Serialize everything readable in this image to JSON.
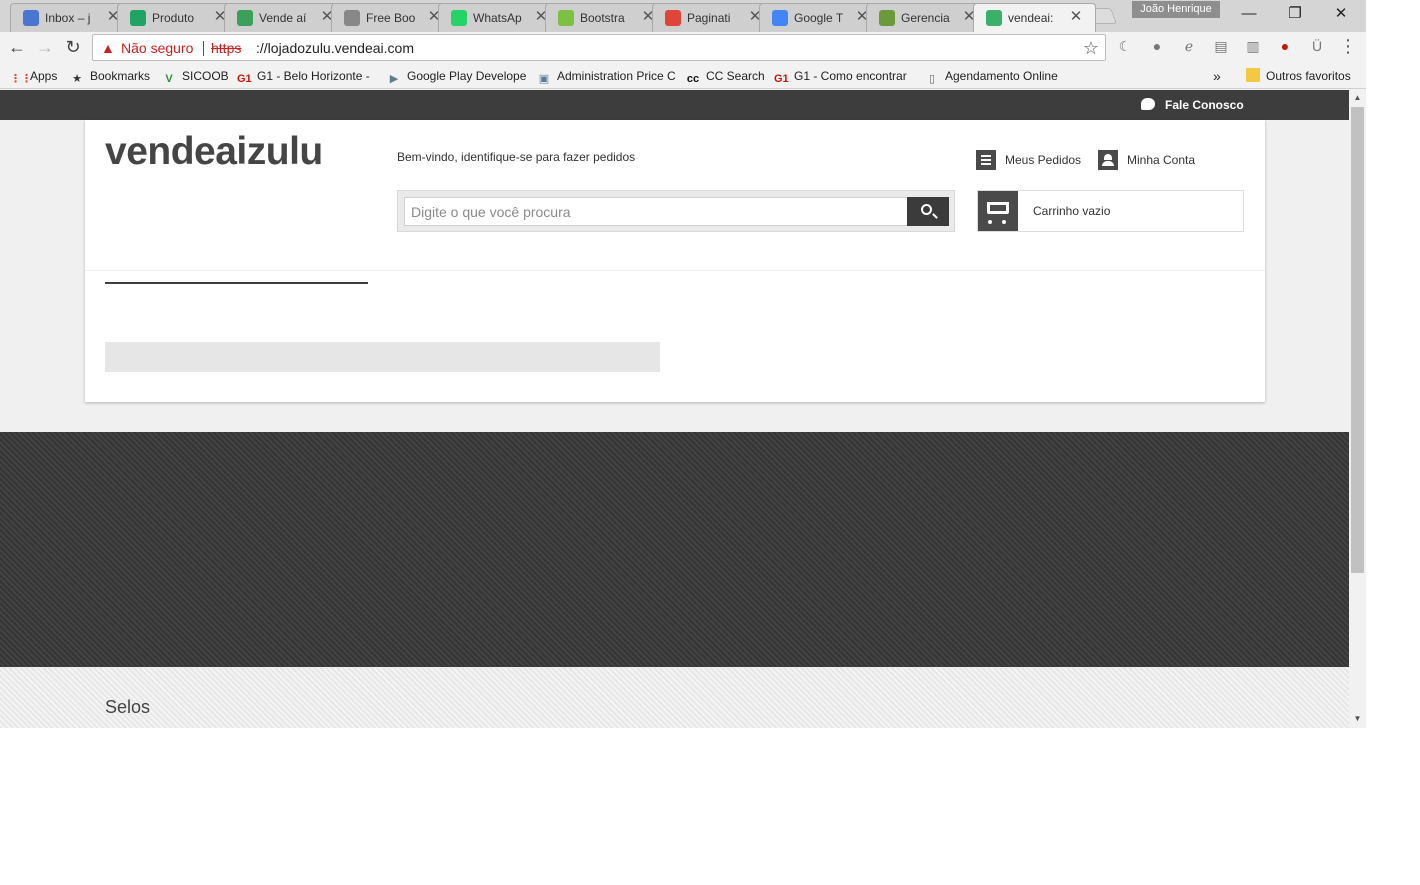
{
  "browser": {
    "tabs": [
      {
        "title": "Inbox – j",
        "icon": "mail-icon",
        "icon_color": "#4a76d0"
      },
      {
        "title": "Produto",
        "icon": "sheets-icon",
        "icon_color": "#1fa463"
      },
      {
        "title": "Vende aí",
        "icon": "vendeai-icon",
        "icon_color": "#3aa05a"
      },
      {
        "title": "Free Boo",
        "icon": "page-icon",
        "icon_color": "#888888"
      },
      {
        "title": "WhatsAp",
        "icon": "whatsapp-icon",
        "icon_color": "#25d366"
      },
      {
        "title": "Bootstra",
        "icon": "bootstrap-icon",
        "icon_color": "#7cc141"
      },
      {
        "title": "Paginati",
        "icon": "laravel-icon",
        "icon_color": "#e0453a"
      },
      {
        "title": "Google T",
        "icon": "translate-icon",
        "icon_color": "#4285f4"
      },
      {
        "title": "Gerencia",
        "icon": "manager-icon",
        "icon_color": "#6a9a3a"
      },
      {
        "title": "vendeai:",
        "icon": "cube-icon",
        "icon_color": "#3ab06a",
        "active": true
      }
    ],
    "close_glyph": "✕",
    "profile_name": "João Henrique",
    "window_controls": {
      "minimize": "—",
      "restore": "❐",
      "close": "✕"
    },
    "toolbar": {
      "back": "←",
      "forward": "→",
      "reload": "↻",
      "security_warning": "▲",
      "not_secure": "Não seguro",
      "url_scheme": "https",
      "url_rest": "://lojadozulu.vendeai.com",
      "star": "☆"
    },
    "extensions": [
      "moon-icon",
      "bulb-icon",
      "evernote-icon",
      "clip-icon",
      "reader-icon",
      "lastpass-icon",
      "umlaut-icon"
    ],
    "extension_glyphs": [
      "☾",
      "●",
      "ℯ",
      "▤",
      "▥",
      "●",
      "Ü"
    ],
    "menu_glyph": "⋮",
    "bookmarks": [
      {
        "label": "Apps",
        "icon": "apps-icon",
        "glyph": "⋮⋮",
        "color": "#e0453a"
      },
      {
        "label": "Bookmarks",
        "icon": "star-icon",
        "glyph": "★",
        "color": "#333333"
      },
      {
        "label": "SICOOB",
        "icon": "sicoob-icon",
        "glyph": "V",
        "color": "#2f8a3c"
      },
      {
        "label": "G1 - Belo Horizonte -",
        "icon": "g1-icon",
        "glyph": "G1",
        "color": "#c4170c"
      },
      {
        "label": "Google Play Develope",
        "icon": "play-icon",
        "glyph": "▶",
        "color": "#607d8b"
      },
      {
        "label": "Administration Price C",
        "icon": "admin-icon",
        "glyph": "▣",
        "color": "#5a7aa0"
      },
      {
        "label": "CC Search",
        "icon": "cc-icon",
        "glyph": "cc",
        "color": "#111111"
      },
      {
        "label": "G1 - Como encontrar",
        "icon": "g1-icon",
        "glyph": "G1",
        "color": "#c4170c"
      },
      {
        "label": "Agendamento Online",
        "icon": "page-icon",
        "glyph": "▯",
        "color": "#666666"
      }
    ],
    "bookmarks_overflow": "»",
    "other_bookmarks": "Outros favoritos"
  },
  "page": {
    "topbar_link": "Fale Conosco",
    "logo": "vendeaizulu",
    "welcome": "Bem-vindo, identifique-se para fazer pedidos",
    "search_placeholder": "Digite o que você procura",
    "my_orders": "Meus Pedidos",
    "my_account": "Minha Conta",
    "cart": "Carrinho vazio",
    "footer_heading": "Selos"
  },
  "scrollbar": {
    "up": "▲",
    "down": "▼"
  }
}
